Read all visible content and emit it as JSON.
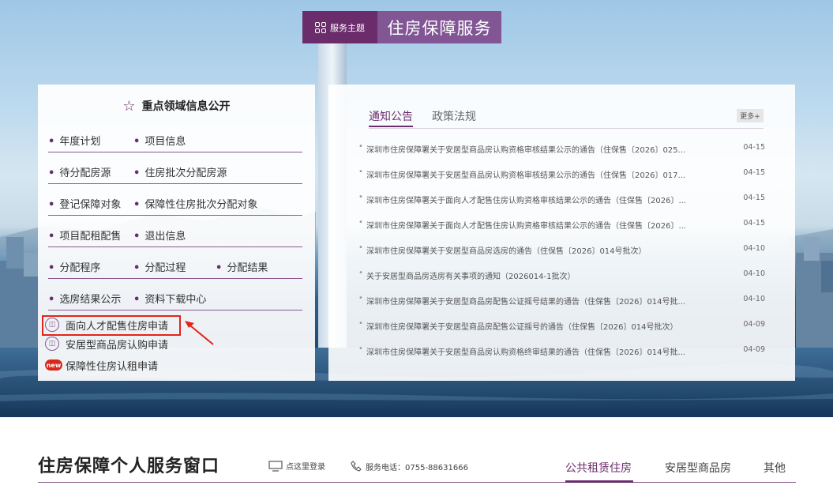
{
  "banner": {
    "tag_label": "服务主题",
    "title": "住房保障服务"
  },
  "key_info": {
    "heading": "重点领域信息公开",
    "rows": [
      [
        "年度计划",
        "项目信息"
      ],
      [
        "待分配房源",
        "住房批次分配房源"
      ],
      [
        "登记保障对象",
        "保障性住房批次分配对象"
      ],
      [
        "项目配租配售",
        "退出信息"
      ],
      [
        "分配程序",
        "分配过程",
        "分配结果"
      ],
      [
        "选房结果公示",
        "资料下载中心"
      ]
    ],
    "applications": [
      "面向人才配售住房申请",
      "安居型商品房认购申请",
      "保障性住房认租申请"
    ],
    "new_badge": "new"
  },
  "news": {
    "tabs": [
      "通知公告",
      "政策法规"
    ],
    "more_label": "更多+",
    "items": [
      {
        "title": "深圳市住房保障署关于安居型商品房认购资格审核结果公示的通告（住保售〔2026〕025...",
        "date": "04-15"
      },
      {
        "title": "深圳市住房保障署关于安居型商品房认购资格审核结果公示的通告（住保售〔2026〕017...",
        "date": "04-15"
      },
      {
        "title": "深圳市住房保障署关于面向人才配售住房认购资格审核结果公示的通告（住保售〔2026〕...",
        "date": "04-15"
      },
      {
        "title": "深圳市住房保障署关于面向人才配售住房认购资格审核结果公示的通告（住保售〔2026〕...",
        "date": "04-15"
      },
      {
        "title": "深圳市住房保障署关于安居型商品房选房的通告（住保售〔2026〕014号批次）",
        "date": "04-10"
      },
      {
        "title": "关于安居型商品房选房有关事项的通知（2026014-1批次）",
        "date": "04-10"
      },
      {
        "title": "深圳市住房保障署关于安居型商品房配售公证摇号结果的通告（住保售〔2026〕014号批...",
        "date": "04-10"
      },
      {
        "title": "深圳市住房保障署关于安居型商品房配售公证摇号的通告（住保售〔2026〕014号批次）",
        "date": "04-09"
      },
      {
        "title": "深圳市住房保障署关于安居型商品房认购资格终审结果的通告（住保售〔2026〕014号批...",
        "date": "04-09"
      }
    ]
  },
  "service": {
    "title": "住房保障个人服务窗口",
    "login_label": "点这里登录",
    "hotline_label": "服务电话：0755-88631666",
    "tabs": [
      "公共租赁住房",
      "安居型商品房",
      "其他"
    ]
  },
  "colors": {
    "brand_purple": "#6b2c6c",
    "highlight_red": "#e1251b",
    "new_badge_red": "#d8281d"
  }
}
